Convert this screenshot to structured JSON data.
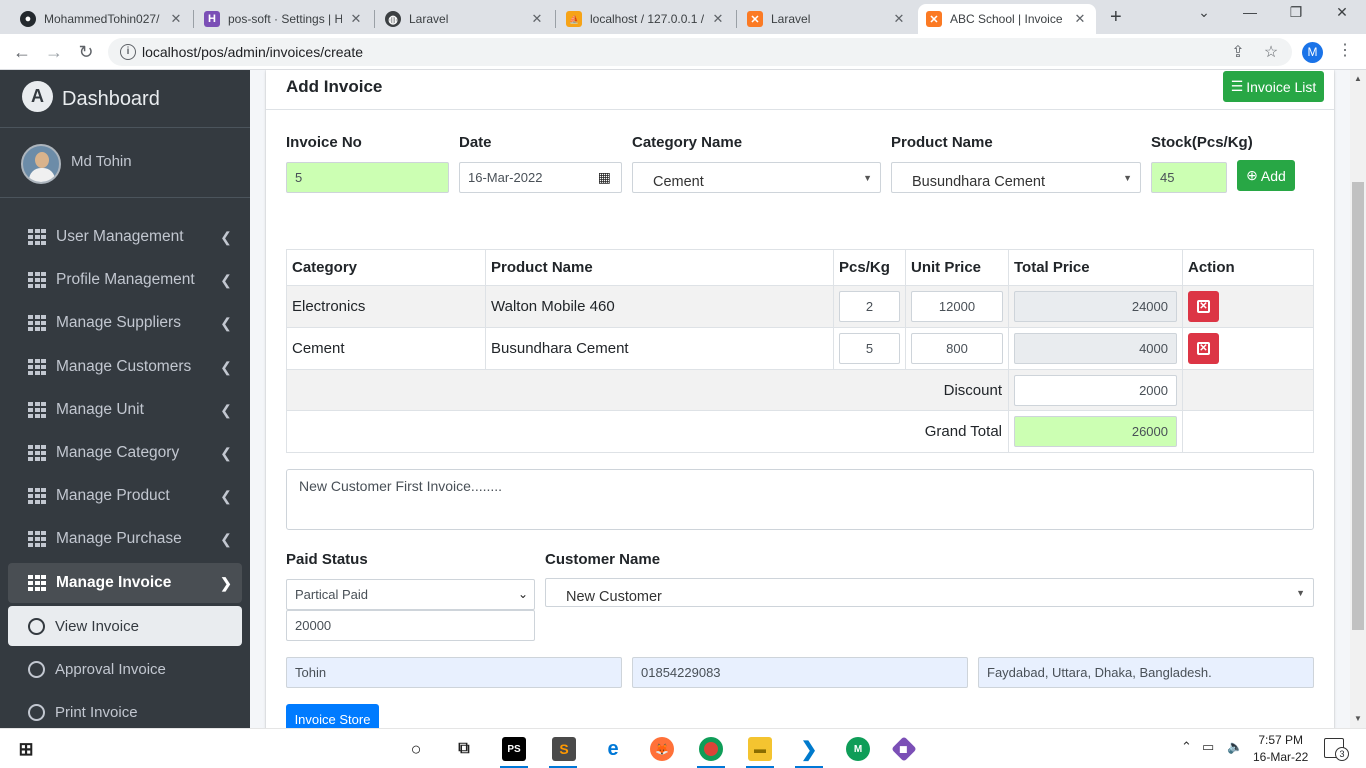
{
  "browser": {
    "tabs": [
      {
        "label": "MohammedTohin027/",
        "icon": "github-icon"
      },
      {
        "label": "pos-soft · Settings | He",
        "icon": "heroku-icon"
      },
      {
        "label": "Laravel",
        "icon": "globe-icon"
      },
      {
        "label": "localhost / 127.0.0.1 /",
        "icon": "phpmyadmin-icon"
      },
      {
        "label": "Laravel",
        "icon": "xampp-icon"
      },
      {
        "label": "ABC School | Invoice",
        "icon": "xampp-icon"
      }
    ],
    "url": "localhost/pos/admin/invoices/create",
    "profile_initial": "M"
  },
  "sidebar": {
    "brand": "Dashboard",
    "brand_logo": "A",
    "user_name": "Md Tohin",
    "menu": [
      {
        "label": "User Management"
      },
      {
        "label": "Profile Management"
      },
      {
        "label": "Manage Suppliers"
      },
      {
        "label": "Manage Customers"
      },
      {
        "label": "Manage Unit"
      },
      {
        "label": "Manage Category"
      },
      {
        "label": "Manage Product"
      },
      {
        "label": "Manage Purchase"
      },
      {
        "label": "Manage Invoice"
      }
    ],
    "submenu": [
      {
        "label": "View Invoice"
      },
      {
        "label": "Approval Invoice"
      },
      {
        "label": "Print Invoice"
      }
    ]
  },
  "page": {
    "title": "Add Invoice",
    "invoice_list_button": "Invoice List",
    "labels": {
      "invoice_no": "Invoice No",
      "date": "Date",
      "category": "Category Name",
      "product": "Product Name",
      "stock": "Stock(Pcs/Kg)",
      "paid_status": "Paid Status",
      "customer": "Customer Name"
    },
    "values": {
      "invoice_no": "5",
      "date": "16-Mar-2022",
      "category": "Cement",
      "product": "Busundhara Cement",
      "stock": "45"
    },
    "add_button": "Add",
    "table": {
      "headers": [
        "Category",
        "Product Name",
        "Pcs/Kg",
        "Unit Price",
        "Total Price",
        "Action"
      ],
      "rows": [
        {
          "category": "Electronics",
          "product": "Walton Mobile 460",
          "qty": "2",
          "unit_price": "12000",
          "total": "24000"
        },
        {
          "category": "Cement",
          "product": "Busundhara Cement",
          "qty": "5",
          "unit_price": "800",
          "total": "4000"
        }
      ],
      "discount_label": "Discount",
      "discount_value": "2000",
      "grand_total_label": "Grand Total",
      "grand_total_value": "26000"
    },
    "description": "New Customer First Invoice........",
    "paid_status": "Partical Paid",
    "paid_amount": "20000",
    "customer": "New Customer",
    "customer_name": "Tohin",
    "customer_mobile": "01854229083",
    "customer_address": "Faydabad, Uttara, Dhaka, Bangladesh.",
    "submit_button": "Invoice Store"
  },
  "taskbar": {
    "time": "7:57 PM",
    "date": "16-Mar-22",
    "notifications": "3"
  },
  "colors": {
    "sidebar_bg": "#343a40",
    "success": "#28a745",
    "danger": "#dc3545",
    "primary": "#007bff",
    "readonly_green": "#ccffb3",
    "readonly_blue": "#e8f0fe"
  }
}
